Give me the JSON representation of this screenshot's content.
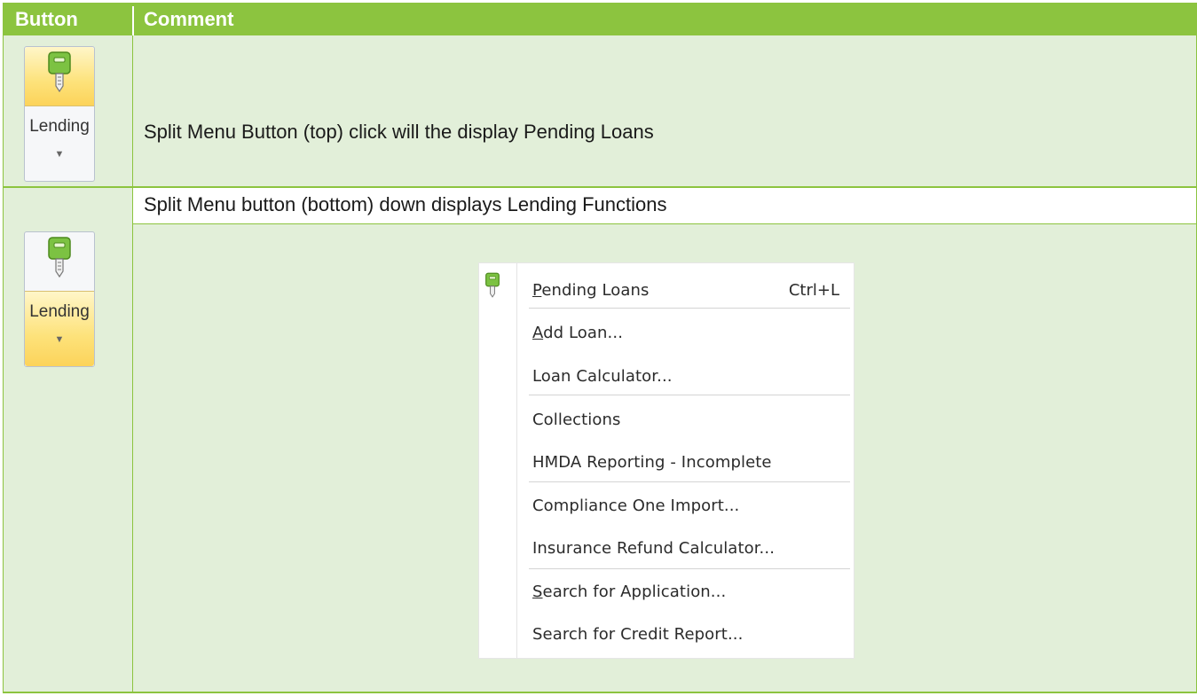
{
  "header": {
    "button_label": "Button",
    "comment_label": "Comment"
  },
  "row1": {
    "button_label": "Lending",
    "comment": "Split Menu Button (top) click will the display Pending Loans"
  },
  "row2": {
    "button_label": "Lending",
    "subheading": "Split Menu button (bottom) down displays Lending Functions"
  },
  "menu": {
    "items": [
      {
        "label": "Pending Loans",
        "shortcut": "Ctrl+L"
      },
      {
        "label": "Add Loan..."
      },
      {
        "label": "Loan Calculator..."
      },
      {
        "label": "Collections"
      },
      {
        "label": "HMDA Reporting - Incomplete"
      },
      {
        "label": "Compliance One Import..."
      },
      {
        "label": "Insurance Refund Calculator..."
      },
      {
        "label": "Search for Application..."
      },
      {
        "label": "Search for Credit Report..."
      }
    ]
  },
  "icons": [
    "key-icon",
    "dropdown-arrow-icon"
  ],
  "colors": {
    "header_green": "#8cc43f",
    "row_green": "#e2efd9",
    "key_green": "#7cc242",
    "highlight_yellow": "#fde27a"
  }
}
